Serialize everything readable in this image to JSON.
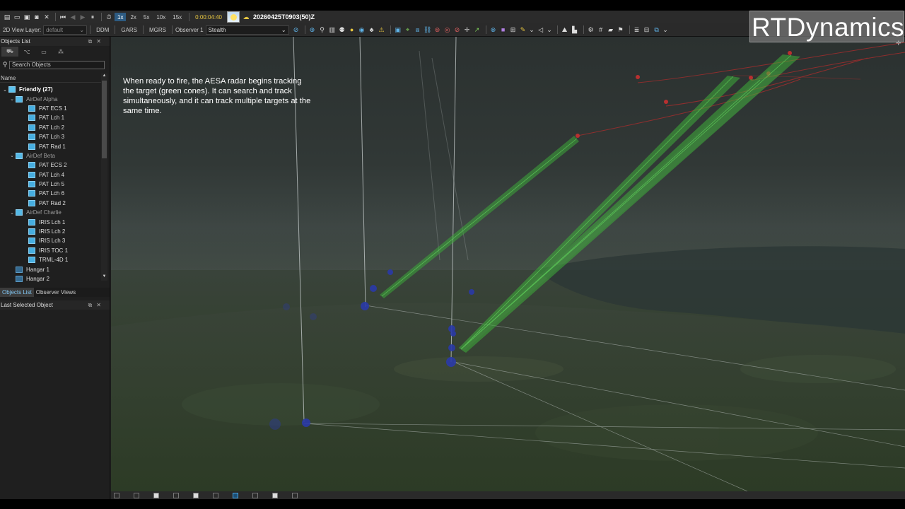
{
  "toolbar": {
    "speeds": [
      "1x",
      "2x",
      "5x",
      "10x",
      "15x"
    ],
    "active_speed": "1x",
    "elapsed": "0:00:04:40",
    "datetime_group": "20260425T0903(50)Z"
  },
  "toolbar2": {
    "view_layer_label": "2D View Layer:",
    "view_layer_value": "default",
    "ddm": "DDM",
    "gars": "GARS",
    "mgrs": "MGRS",
    "observer_label": "Observer 1",
    "observer_value": "Stealth"
  },
  "objects_panel": {
    "title": "Objects List",
    "search_placeholder": "Search Objects",
    "column_name": "Name",
    "tree": [
      {
        "label": "Friendly (27)",
        "level": 0,
        "kind": "root"
      },
      {
        "label": "AirDef Alpha",
        "level": 1,
        "kind": "group"
      },
      {
        "label": "PAT ECS 1",
        "level": 2,
        "kind": "item"
      },
      {
        "label": "PAT Lch 1",
        "level": 2,
        "kind": "item"
      },
      {
        "label": "PAT Lch 2",
        "level": 2,
        "kind": "item"
      },
      {
        "label": "PAT Lch 3",
        "level": 2,
        "kind": "item"
      },
      {
        "label": "PAT Rad 1",
        "level": 2,
        "kind": "item"
      },
      {
        "label": "AirDef Beta",
        "level": 1,
        "kind": "group"
      },
      {
        "label": "PAT ECS 2",
        "level": 2,
        "kind": "item"
      },
      {
        "label": "PAT Lch 4",
        "level": 2,
        "kind": "item"
      },
      {
        "label": "PAT Lch 5",
        "level": 2,
        "kind": "item"
      },
      {
        "label": "PAT Lch 6",
        "level": 2,
        "kind": "item"
      },
      {
        "label": "PAT Rad 2",
        "level": 2,
        "kind": "item"
      },
      {
        "label": "AirDef Charlie",
        "level": 1,
        "kind": "group"
      },
      {
        "label": "IRIS Lch 1",
        "level": 2,
        "kind": "item"
      },
      {
        "label": "IRIS Lch 2",
        "level": 2,
        "kind": "item"
      },
      {
        "label": "IRIS Lch 3",
        "level": 2,
        "kind": "item"
      },
      {
        "label": "IRIS TOC 1",
        "level": 2,
        "kind": "item"
      },
      {
        "label": "TRML-4D 1",
        "level": 2,
        "kind": "item"
      },
      {
        "label": "Hangar 1",
        "level": 1,
        "kind": "hangar"
      },
      {
        "label": "Hangar 2",
        "level": 1,
        "kind": "hangar"
      }
    ],
    "bottom_tabs": [
      "Objects List",
      "Observer Views"
    ],
    "last_selected_title": "Last Selected Object"
  },
  "view": {
    "caption": "When ready to fire, the AESA radar begins tracking the target (green cones). It can search and track simultaneously, and it can track multiple targets at the same time."
  },
  "logo": "RTDynamics",
  "colors": {
    "accent": "#2d5b82",
    "track_cone": "#3fae3a",
    "threat_line": "#c03030",
    "unit_marker": "#2a3aa8"
  }
}
